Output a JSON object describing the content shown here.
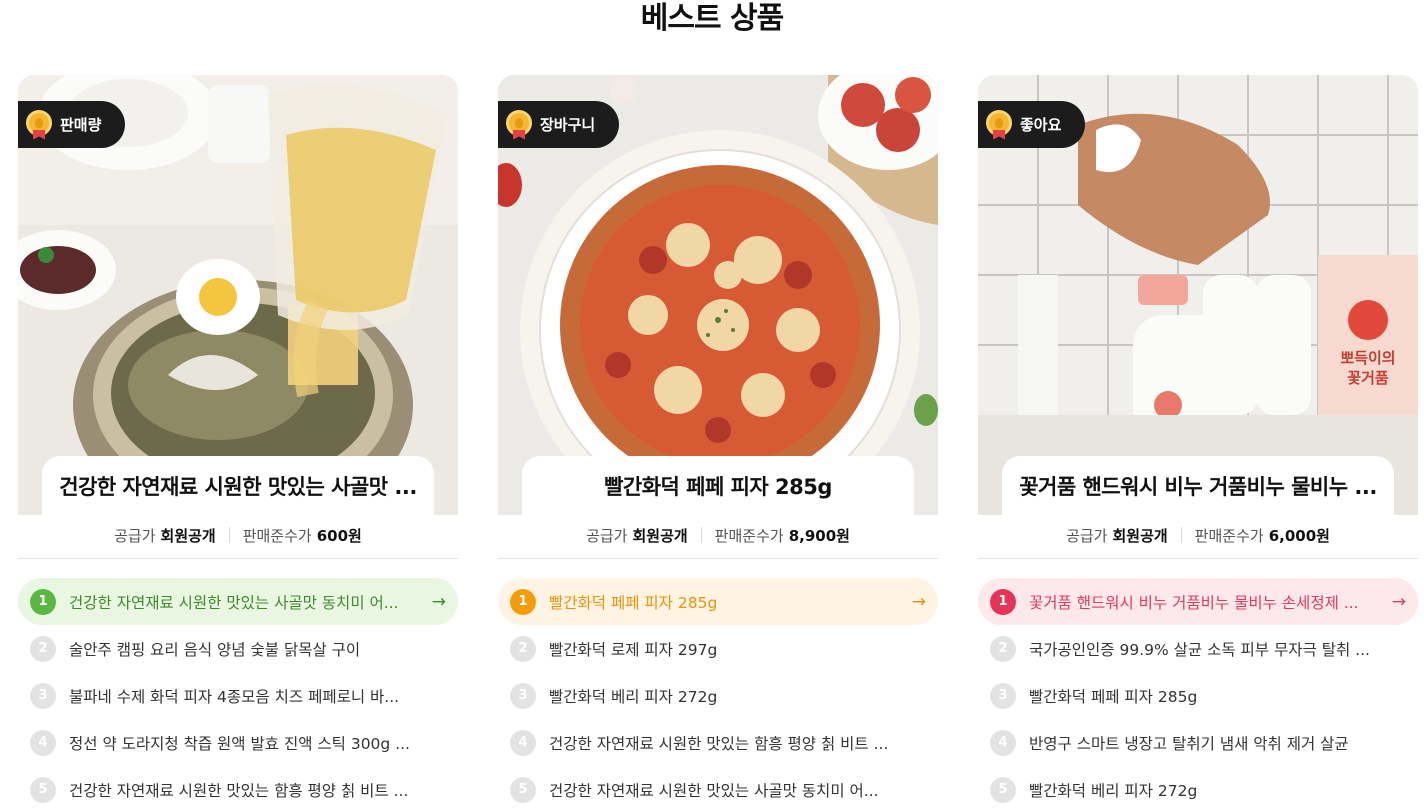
{
  "page_title": "베스트 상품",
  "columns": [
    {
      "tag": "판매량",
      "product_title": "건강한 자연재료 시원한 맛있는 사골맛 ...",
      "price_label": "공급가",
      "price_value": "회원공개",
      "msrp_label": "판매준수가",
      "msrp_value": "600원",
      "active_color": "#5bb744",
      "items": [
        {
          "rank": "1",
          "text": "건강한 자연재료 시원한 맛있는 사골맛 동치미 어...",
          "arrow": "→"
        },
        {
          "rank": "2",
          "text": "술안주 캠핑 요리 음식 양념 숯불 닭목살 구이"
        },
        {
          "rank": "3",
          "text": "불파네 수제 화덕 피자 4종모음 치즈 페페로니 바..."
        },
        {
          "rank": "4",
          "text": "정선 약 도라지청 착즙 원액 발효 진액 스틱 300g ..."
        },
        {
          "rank": "5",
          "text": "건강한 자연재료 시원한 맛있는 함흥 평양 칡 비트 ..."
        }
      ]
    },
    {
      "tag": "장바구니",
      "product_title": "빨간화덕 페페 피자 285g",
      "price_label": "공급가",
      "price_value": "회원공개",
      "msrp_label": "판매준수가",
      "msrp_value": "8,900원",
      "active_color": "#f49d0c",
      "items": [
        {
          "rank": "1",
          "text": "빨간화덕 페페 피자 285g",
          "arrow": "→"
        },
        {
          "rank": "2",
          "text": "빨간화덕 로제 피자 297g"
        },
        {
          "rank": "3",
          "text": "빨간화덕 베리 피자 272g"
        },
        {
          "rank": "4",
          "text": "건강한 자연재료 시원한 맛있는 함흥 평양 칡 비트 ..."
        },
        {
          "rank": "5",
          "text": "건강한 자연재료 시원한 맛있는 사골맛 동치미 어..."
        }
      ]
    },
    {
      "tag": "좋아요",
      "product_title": "꽃거품 핸드워시 비누 거품비누 물비누 ...",
      "price_label": "공급가",
      "price_value": "회원공개",
      "msrp_label": "판매준수가",
      "msrp_value": "6,000원",
      "active_color": "#e5345a",
      "image_text": [
        "뽀득이의",
        "꽃거품"
      ],
      "items": [
        {
          "rank": "1",
          "text": "꽃거품 핸드워시 비누 거품비누 물비누 손세정제 ...",
          "arrow": "→"
        },
        {
          "rank": "2",
          "text": "국가공인인증 99.9% 살균 소독 피부 무자극 탈취 ..."
        },
        {
          "rank": "3",
          "text": "빨간화덕 페페 피자 285g"
        },
        {
          "rank": "4",
          "text": "반영구 스마트 냉장고 탈취기 냄새 악취 제거 살균"
        },
        {
          "rank": "5",
          "text": "빨간화덕 베리 피자 272g"
        }
      ]
    }
  ]
}
